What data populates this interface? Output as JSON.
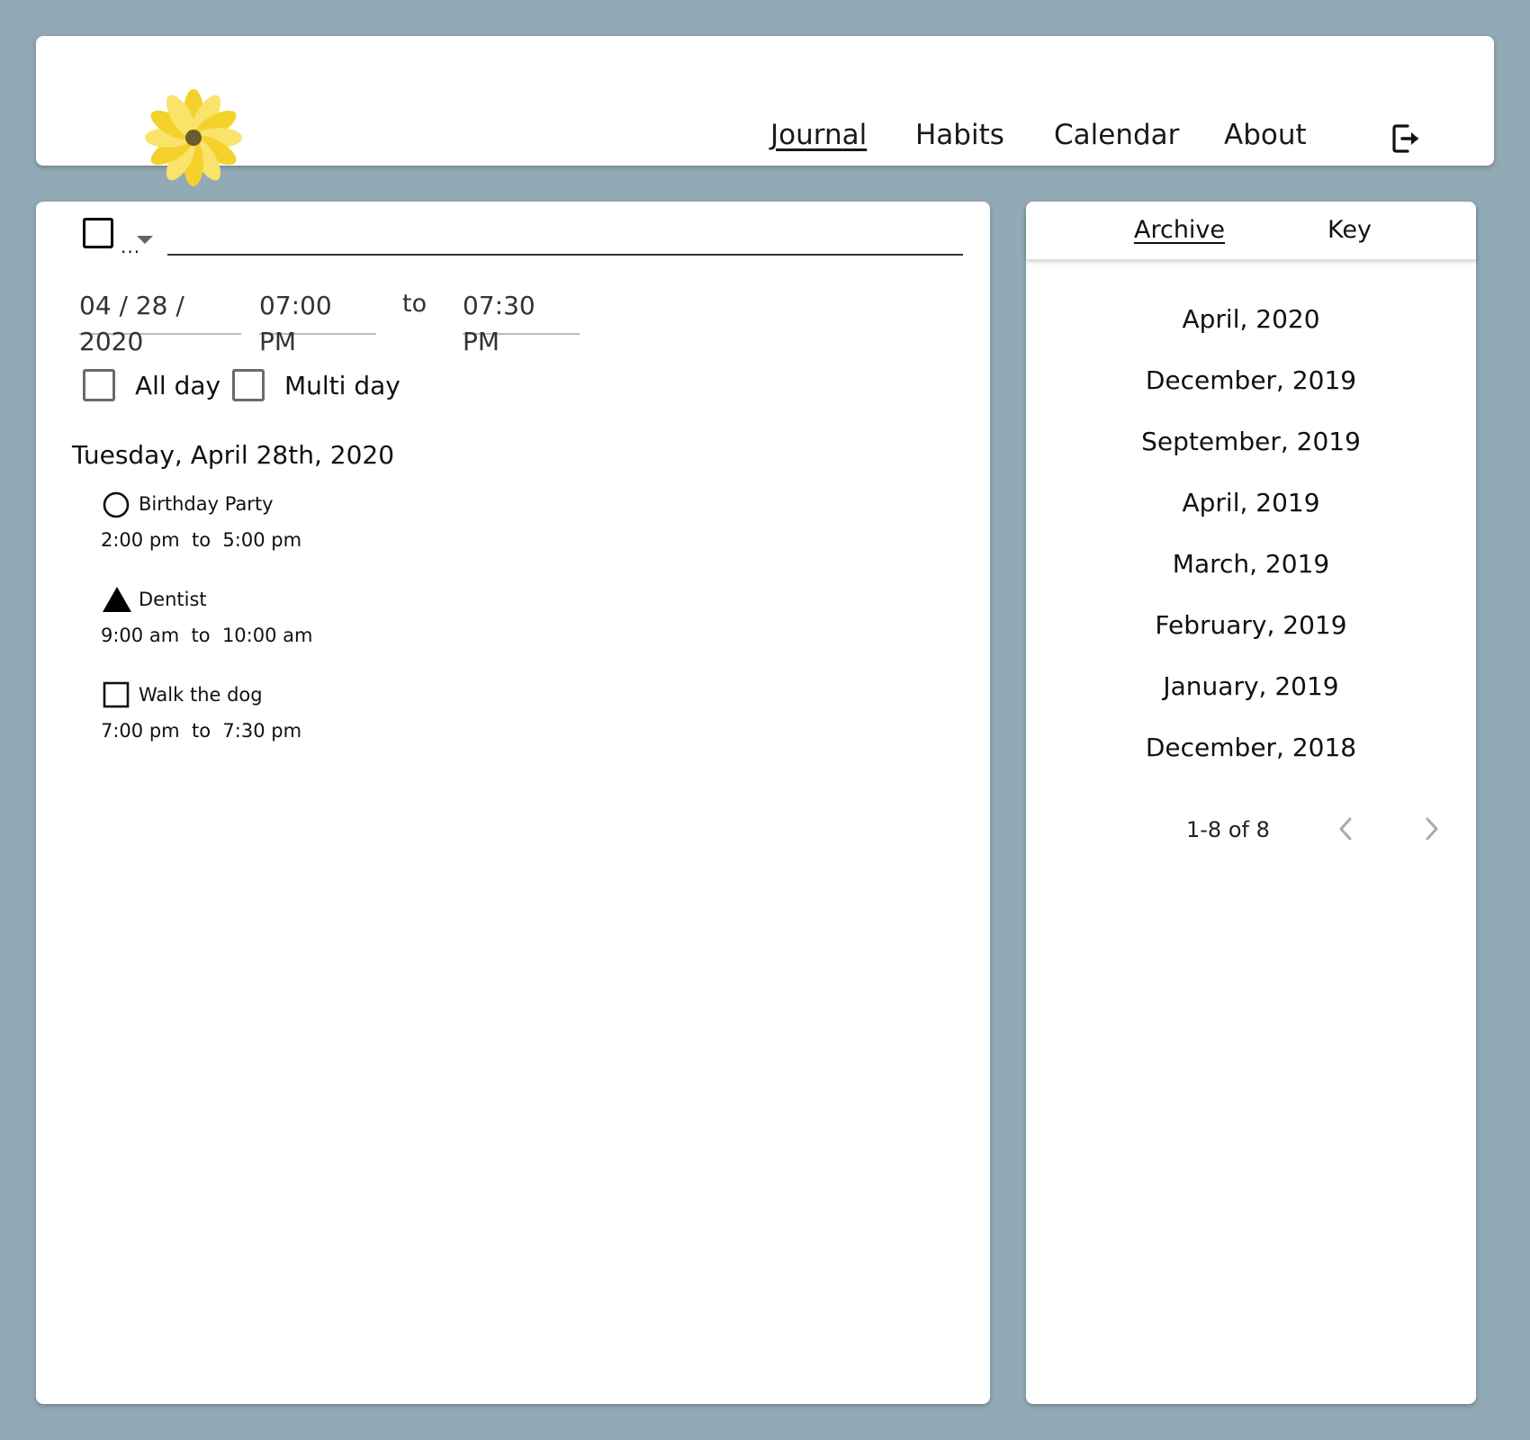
{
  "nav": {
    "items": [
      {
        "label": "Journal",
        "active": true
      },
      {
        "label": "Habits",
        "active": false
      },
      {
        "label": "Calendar",
        "active": false
      },
      {
        "label": "About",
        "active": false
      }
    ],
    "logout_icon": "logout-icon",
    "logo_icon": "sunflower-logo"
  },
  "entry_form": {
    "type_menu_label": "...",
    "title_value": "",
    "date": "04 / 28 / 2020",
    "start_time": "07:00 PM",
    "to_label": "to",
    "end_time": "07:30 PM",
    "all_day_label": "All day",
    "multi_day_label": "Multi day"
  },
  "day": {
    "heading": "Tuesday, April 28th, 2020",
    "events": [
      {
        "icon": "circle-icon",
        "title": "Birthday Party",
        "time": "2:00 pm  to  5:00 pm"
      },
      {
        "icon": "triangle-icon",
        "title": "Dentist",
        "time": "9:00 am  to  10:00 am"
      },
      {
        "icon": "square-icon",
        "title": "Walk the dog",
        "time": "7:00 pm  to  7:30 pm"
      }
    ]
  },
  "sidebar": {
    "tabs": [
      {
        "label": "Archive",
        "active": true
      },
      {
        "label": "Key",
        "active": false
      }
    ],
    "months": [
      "April, 2020",
      "December, 2019",
      "September, 2019",
      "April, 2019",
      "March, 2019",
      "February, 2019",
      "January, 2019",
      "December, 2018"
    ],
    "pagination": {
      "text": "1-8 of 8",
      "prev_icon": "chevron-left-icon",
      "next_icon": "chevron-right-icon"
    }
  },
  "colors": {
    "background": "#92aab6",
    "card": "#ffffff",
    "logo_petal": "#f7d63a",
    "logo_center": "#6b5a2c"
  }
}
